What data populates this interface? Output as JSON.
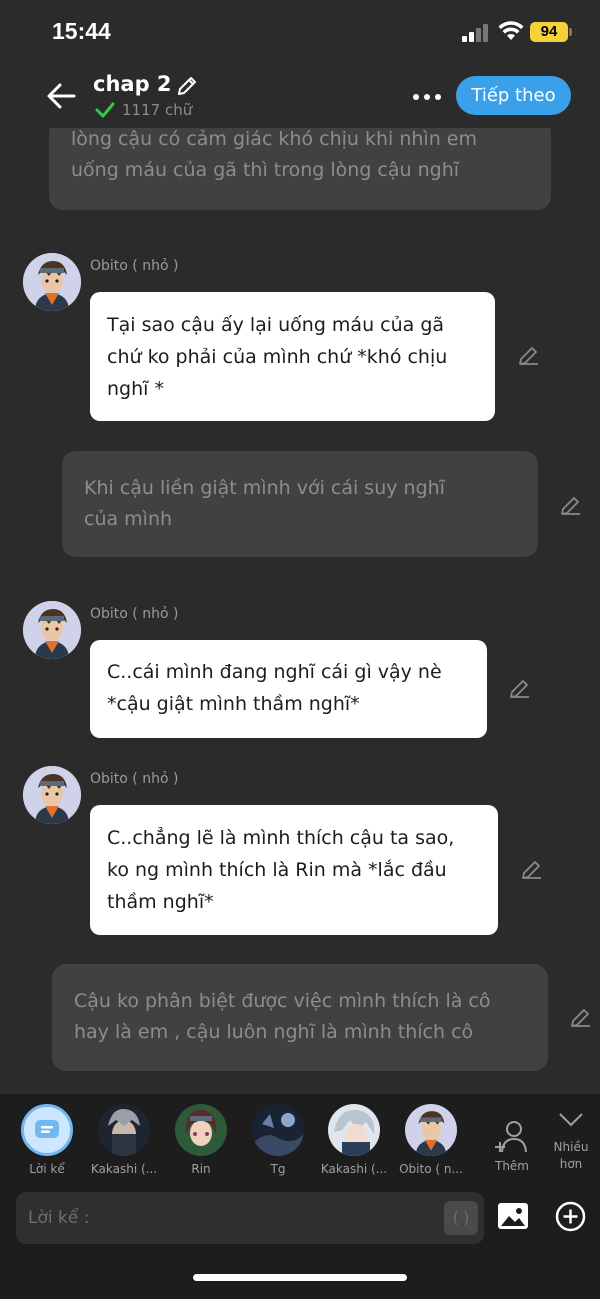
{
  "status_bar": {
    "time": "15:44",
    "battery": "94"
  },
  "header": {
    "title": "chap 2",
    "word_count": "1117 chữ",
    "next_label": "Tiếp theo"
  },
  "messages": [
    {
      "type": "narration",
      "text": "lòng cậu có cảm giác khó chịu khi nhìn em\nuống máu của gã thì trong lòng cậu nghĩ"
    },
    {
      "type": "character",
      "name": "Obito ( nhỏ )",
      "text": "Tại sao cậu ấy lại uống máu của gã\nchứ ko phải của mình chứ *khó chịu\nnghĩ *"
    },
    {
      "type": "narration",
      "text": "Khi cậu liền giật mình với cái suy nghĩ\ncủa mình"
    },
    {
      "type": "character",
      "name": "Obito ( nhỏ )",
      "text": "C..cái mình đang nghĩ cái gì vậy nè\n*cậu giật mình thầm nghĩ*"
    },
    {
      "type": "character",
      "name": "Obito ( nhỏ )",
      "text": "C..chẳng lẽ là mình thích cậu ta sao,\nko ng mình thích là Rin mà *lắc đầu\nthầm nghĩ*"
    },
    {
      "type": "narration",
      "text": "Cậu ko phân biệt được việc mình thích là cô\nhay là em , cậu luôn nghĩ là mình thích cô"
    }
  ],
  "characters": [
    {
      "label": "Lời kể"
    },
    {
      "label": "Kakashi (..."
    },
    {
      "label": "Rin"
    },
    {
      "label": "Tg"
    },
    {
      "label": "Kakashi (..."
    },
    {
      "label": "Obito ( n..."
    }
  ],
  "actions": {
    "add_label": "Thêm",
    "more_label": "Nhiều\nhơn"
  },
  "composer": {
    "placeholder": "Lời kể :",
    "paren_label": "( )"
  }
}
